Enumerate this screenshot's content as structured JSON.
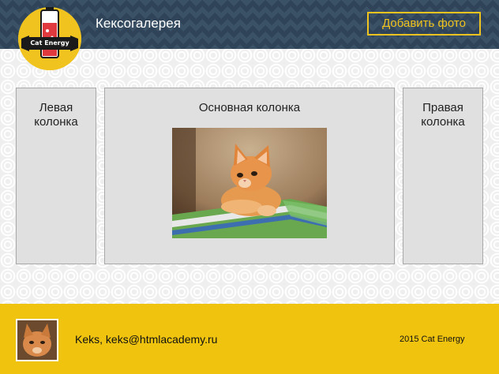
{
  "header": {
    "logo_text": "Cat Energy",
    "title": "Кексогалерея",
    "add_photo_label": "Добавить фото"
  },
  "columns": {
    "left": {
      "title": "Левая колонка"
    },
    "main": {
      "title": "Основная колонка",
      "image": "kitten-photo"
    },
    "right": {
      "title": "Правая колонка"
    }
  },
  "footer": {
    "avatar": "user-avatar-photo",
    "contact": "Keks, keks@htmlacademy.ru",
    "copyright": "2015 Cat Energy"
  },
  "colors": {
    "header_bg": "#2f4458",
    "accent": "#f0c31e",
    "footer_bg": "#f0c30f",
    "column_bg": "#e0e0e0"
  }
}
